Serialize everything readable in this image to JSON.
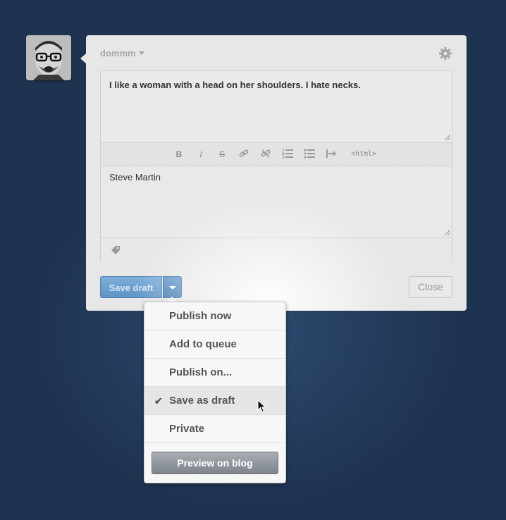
{
  "post": {
    "blog_name": "dommm",
    "quote_text": "I like a woman with a head on her shoulders. I hate necks.",
    "source_text": "Steve Martin"
  },
  "toolbar": {
    "bold": "B",
    "italic": "I",
    "strike": "S",
    "html": "<html>"
  },
  "actions": {
    "save_label": "Save draft",
    "close_label": "Close"
  },
  "menu": {
    "items": [
      {
        "label": "Publish now"
      },
      {
        "label": "Add to queue"
      },
      {
        "label": "Publish on..."
      },
      {
        "label": "Save as draft",
        "selected": true
      },
      {
        "label": "Private"
      }
    ],
    "check_glyph": "✔",
    "preview_label": "Preview on blog"
  },
  "colors": {
    "background": "#1e3350",
    "save_button": "#6a9fd0",
    "card": "#e7e7e7"
  }
}
